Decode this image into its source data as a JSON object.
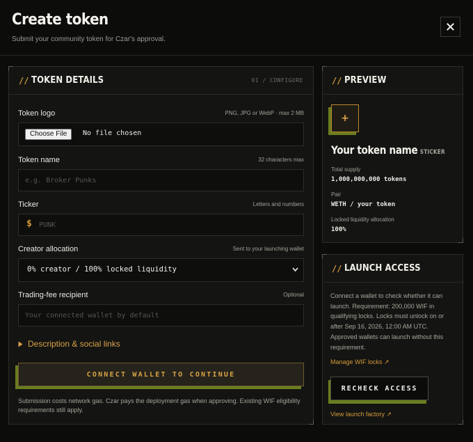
{
  "header": {
    "title": "Create token",
    "subtitle": "Submit your community token for Czar's approval.",
    "close_icon": "close-icon"
  },
  "details": {
    "slash": "//",
    "title": "TOKEN DETAILS",
    "step": "01 / CONFIGURE",
    "logo": {
      "label": "Token logo",
      "hint": "PNG, JPG or WebP · max 2 MB",
      "button": "Choose File",
      "status": "No file chosen"
    },
    "name": {
      "label": "Token name",
      "hint": "32 characters max",
      "value": "",
      "placeholder": "e.g. Broker Punks"
    },
    "ticker": {
      "label": "Ticker",
      "hint": "Letters and numbers",
      "prefix": "$",
      "value": "",
      "placeholder": "PUNK"
    },
    "allocation": {
      "label": "Creator allocation",
      "hint": "Sent to your launching wallet",
      "selected": "0% creator / 100% locked liquidity"
    },
    "recipient": {
      "label": "Trading-fee recipient",
      "hint": "Optional",
      "value": "",
      "placeholder": "Your connected wallet by default"
    },
    "description_toggle": "Description & social links",
    "connect_button": "CONNECT WALLET TO CONTINUE",
    "note": "Submission costs network gas. Czar pays the deployment gas when approving. Existing WIF eligibility requirements still apply."
  },
  "preview": {
    "slash": "//",
    "title": "PREVIEW",
    "logo_glyph": "+",
    "token_name": "Your token name",
    "token_ticker": "STICKER",
    "total_supply_label": "Total supply",
    "total_supply_value": "1,000,000,000 tokens",
    "pair_label": "Pair",
    "pair_value": "WETH / your token",
    "locked_label": "Locked liquidity allocation",
    "locked_value": "100%"
  },
  "access": {
    "slash": "//",
    "title": "LAUNCH ACCESS",
    "text": "Connect a wallet to check whether it can launch. Requirement: 200,000 WIF in qualifying locks. Locks must unlock on or after Sep 16, 2026, 12:00 AM UTC. Approved wallets can launch without this requirement.",
    "manage_link": "Manage WIF locks ↗",
    "recheck_button": "RECHECK ACCESS",
    "factory_link": "View launch factory ↗"
  },
  "colors": {
    "accent": "#d49a3a",
    "olive": "#6a7d1e",
    "background": "#0c0c0b",
    "panel": "#141412"
  }
}
